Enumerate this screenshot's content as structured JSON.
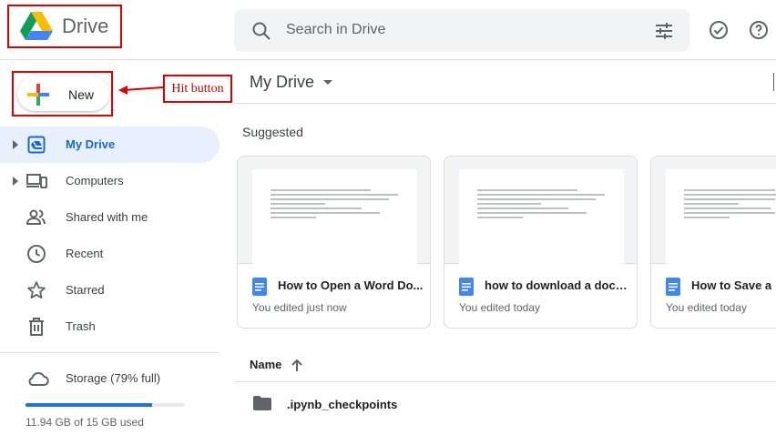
{
  "app": {
    "name": "Drive"
  },
  "search": {
    "placeholder": "Search in Drive"
  },
  "new_button": {
    "label": "New"
  },
  "annotation": {
    "label": "Hit button"
  },
  "sidebar": {
    "items": [
      {
        "label": "My Drive",
        "icon": "my-drive-icon",
        "active": true
      },
      {
        "label": "Computers",
        "icon": "computers-icon"
      },
      {
        "label": "Shared with me",
        "icon": "shared-icon"
      },
      {
        "label": "Recent",
        "icon": "clock-icon"
      },
      {
        "label": "Starred",
        "icon": "star-icon"
      },
      {
        "label": "Trash",
        "icon": "trash-icon"
      }
    ],
    "storage": {
      "label": "Storage (79% full)",
      "used_text": "11.94 GB of 15 GB used",
      "fraction": 0.796
    }
  },
  "main": {
    "title": "My Drive",
    "suggested_label": "Suggested",
    "cards": [
      {
        "name": "How to Open a Word Do...",
        "meta": "You edited just now"
      },
      {
        "name": "how to download a docu...",
        "meta": "You edited today"
      },
      {
        "name": "How to Save a G",
        "meta": "You edited today"
      }
    ],
    "list": {
      "column_name": "Name",
      "rows": [
        {
          "name": ".ipynb_checkpoints"
        }
      ]
    }
  },
  "colors": {
    "accent": "#1a73e8",
    "active_bg": "#e8f0fe",
    "annotation": "#e00000"
  }
}
